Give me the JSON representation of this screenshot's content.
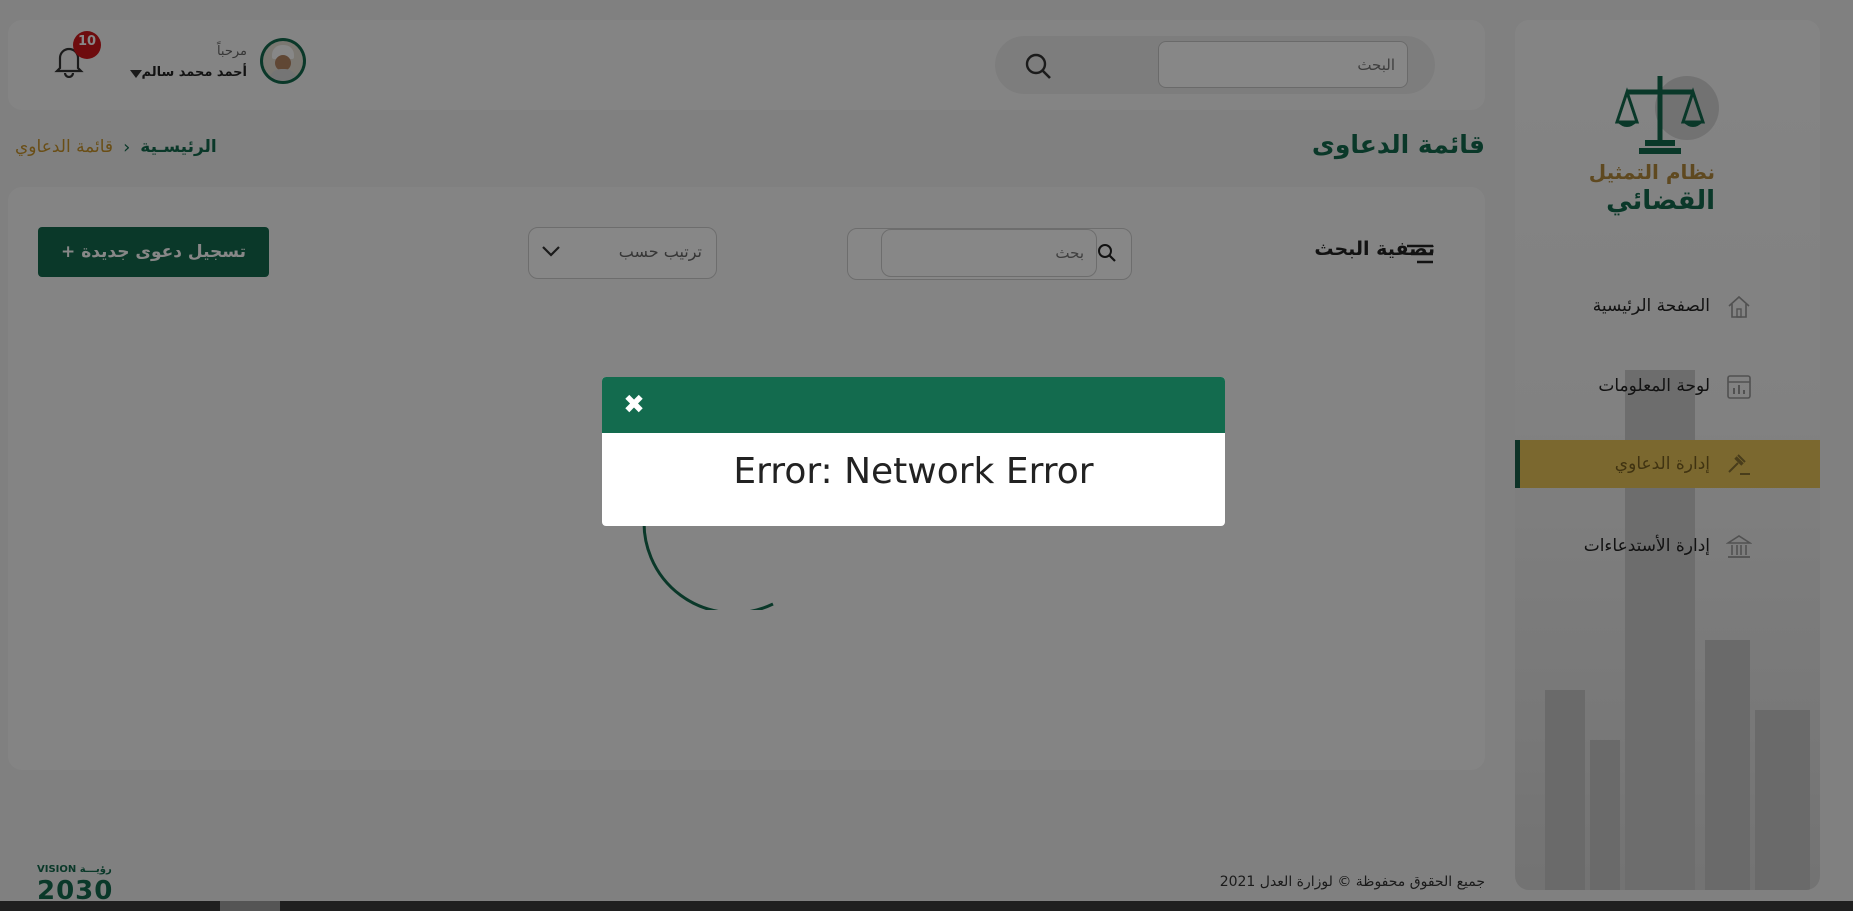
{
  "sidebar": {
    "logo": {
      "line1": "نظام التمثيل",
      "line2": "القضائي"
    },
    "items": [
      {
        "label": "الصفحة الرئيسية",
        "icon": "home-icon",
        "active": false
      },
      {
        "label": "لوحة المعلومات",
        "icon": "dashboard-icon",
        "active": false
      },
      {
        "label": "إدارة الدعاوي",
        "icon": "gavel-icon",
        "active": true
      },
      {
        "label": "إدارة الأستدعاءات",
        "icon": "institution-icon",
        "active": false
      }
    ]
  },
  "header": {
    "search_placeholder": "البحث",
    "greeting": "مرحباً",
    "user_name": "أحمد محمد سالم",
    "notification_count": "10"
  },
  "page": {
    "title": "قائمة الدعاوى",
    "breadcrumb_home": "الرئيسـية",
    "breadcrumb_current": "قائمة الدعاوي"
  },
  "toolbar": {
    "filter_label": "تصفية البحث",
    "search_placeholder": "بحث",
    "sort_label": "ترتيب حسب",
    "new_case_button": "+ تسجيل دعوى جديدة"
  },
  "footer": {
    "copyright": "جميع الحقوق محفوظة © لوزارة العدل 2021",
    "vision_small": "VISION رؤيـــة",
    "vision_year": "2030"
  },
  "modal": {
    "message": "Error: Network Error",
    "close_symbol": "✖"
  },
  "colors": {
    "brand_green": "#136b4e",
    "accent_gold": "#e8c45a",
    "badge_red": "#d0181c"
  }
}
